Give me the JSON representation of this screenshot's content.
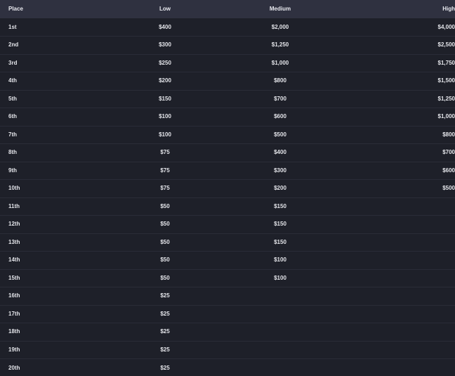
{
  "headers": {
    "place": "Place",
    "low": "Low",
    "medium": "Medium",
    "high": "High"
  },
  "rows": [
    {
      "place": "1st",
      "low": "$400",
      "medium": "$2,000",
      "high": "$4,000"
    },
    {
      "place": "2nd",
      "low": "$300",
      "medium": "$1,250",
      "high": "$2,500"
    },
    {
      "place": "3rd",
      "low": "$250",
      "medium": "$1,000",
      "high": "$1,750"
    },
    {
      "place": "4th",
      "low": "$200",
      "medium": "$800",
      "high": "$1,500"
    },
    {
      "place": "5th",
      "low": "$150",
      "medium": "$700",
      "high": "$1,250"
    },
    {
      "place": "6th",
      "low": "$100",
      "medium": "$600",
      "high": "$1,000"
    },
    {
      "place": "7th",
      "low": "$100",
      "medium": "$500",
      "high": "$800"
    },
    {
      "place": "8th",
      "low": "$75",
      "medium": "$400",
      "high": "$700"
    },
    {
      "place": "9th",
      "low": "$75",
      "medium": "$300",
      "high": "$600"
    },
    {
      "place": "10th",
      "low": "$75",
      "medium": "$200",
      "high": "$500"
    },
    {
      "place": "11th",
      "low": "$50",
      "medium": "$150",
      "high": ""
    },
    {
      "place": "12th",
      "low": "$50",
      "medium": "$150",
      "high": ""
    },
    {
      "place": "13th",
      "low": "$50",
      "medium": "$150",
      "high": ""
    },
    {
      "place": "14th",
      "low": "$50",
      "medium": "$100",
      "high": ""
    },
    {
      "place": "15th",
      "low": "$50",
      "medium": "$100",
      "high": ""
    },
    {
      "place": "16th",
      "low": "$25",
      "medium": "",
      "high": ""
    },
    {
      "place": "17th",
      "low": "$25",
      "medium": "",
      "high": ""
    },
    {
      "place": "18th",
      "low": "$25",
      "medium": "",
      "high": ""
    },
    {
      "place": "19th",
      "low": "$25",
      "medium": "",
      "high": ""
    },
    {
      "place": "20th",
      "low": "$25",
      "medium": "",
      "high": ""
    }
  ]
}
